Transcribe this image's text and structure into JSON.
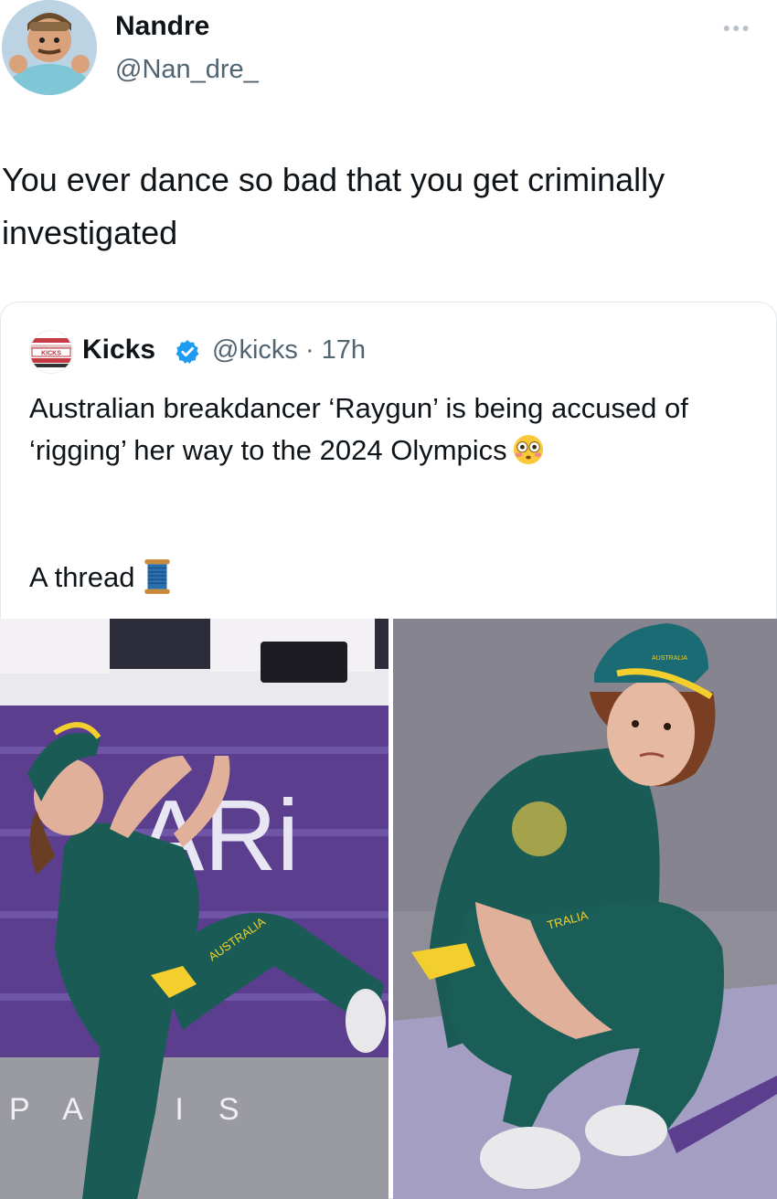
{
  "tweet": {
    "author_name": "Nandre",
    "author_handle": "@Nan_dre_",
    "more_icon": "ellipsis-icon",
    "text": "You ever dance so bad that you get criminally investigated"
  },
  "quoted": {
    "logo_text": "KICKS",
    "author_name": "Kicks",
    "verified_icon": "verified-badge-icon",
    "handle_time": "@kicks · 17h",
    "text": "Australian breakdancer ‘Raygun’ is being accused of ‘rigging’ her way to the 2024 Olympics",
    "text_emoji": "flushed-face-icon",
    "thread_label": "A thread",
    "thread_emoji": "spool-of-thread-icon",
    "images": [
      {
        "name": "photo-breakdancer-posing",
        "overlay_text_1": "ARi",
        "overlay_text_2": "PARIS",
        "jersey_text": "AUSTRALIA"
      },
      {
        "name": "photo-breakdancer-crouching",
        "cap_text": "AUSTRALIA",
        "jersey_text": "TRALIA"
      }
    ]
  },
  "colors": {
    "text_primary": "#0f1419",
    "text_secondary": "#536471",
    "verified_blue": "#1d9bf0",
    "border": "#e3e7ea",
    "uniform_green": "#1a5c55",
    "uniform_gold": "#f2cf2c",
    "stage_purple": "#5b3e8e"
  }
}
